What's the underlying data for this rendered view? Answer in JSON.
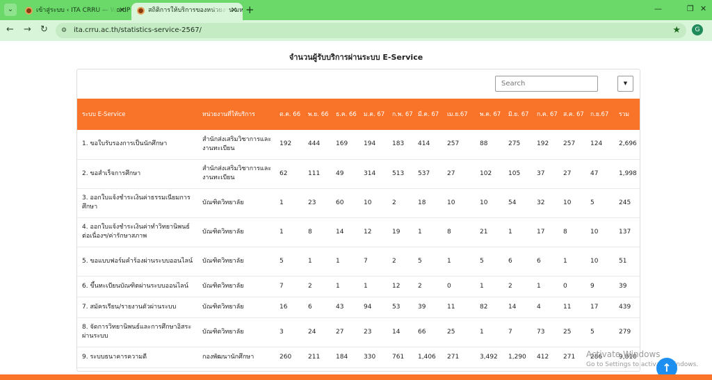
{
  "browser": {
    "tabs": [
      {
        "title": "เข้าสู่ระบบ ‹ ITA CRRU — WordPress"
      },
      {
        "title": "สถิติการให้บริการของหน่วยงาน มหาวิทยาลัย"
      }
    ],
    "url": "ita.crru.ac.th/statistics-service-2567/",
    "profile_initial": "G",
    "icons": {
      "tab_list": "chevron-down-icon",
      "new_tab": "plus-icon",
      "back": "back-arrow-icon",
      "forward": "forward-arrow-icon",
      "reload": "reload-icon",
      "bookmark": "star-icon",
      "scroll_top": "arrow-up-icon"
    }
  },
  "page": {
    "title": "จำนวนผู้รับบริการผ่านระบบ E-Service",
    "search_placeholder": "Search"
  },
  "table": {
    "headers": [
      "ระบบ E-Service",
      "หน่วยงานที่ให้บริการ",
      "ต.ค. 66",
      "พ.ย. 66",
      "ธ.ค. 66",
      "ม.ค. 67",
      "ก.พ. 67",
      "มี.ค. 67",
      "เม.ย.67",
      "พ.ค. 67",
      "มิ.ย. 67",
      "ก.ค. 67",
      "ส.ค. 67",
      "ก.ย.67",
      "รวม"
    ],
    "rows": [
      [
        "1. ขอใบรับรองการเป็นนักศึกษา",
        "สำนักส่งเสริมวิชาการและงานทะเบียน",
        "192",
        "444",
        "169",
        "194",
        "183",
        "414",
        "257",
        "88",
        "275",
        "192",
        "257",
        "124",
        "2,696"
      ],
      [
        "2. ขอสำเร็จการศึกษา",
        "สำนักส่งเสริมวิชาการและงานทะเบียน",
        "62",
        "111",
        "49",
        "314",
        "513",
        "537",
        "27",
        "102",
        "105",
        "37",
        "27",
        "47",
        "1,998"
      ],
      [
        "3. ออกใบแจ้งชำระเงินค่าธรรมเนียมการศึกษา",
        "บัณฑิตวิทยาลัย",
        "1",
        "23",
        "60",
        "10",
        "2",
        "18",
        "10",
        "10",
        "54",
        "32",
        "10",
        "5",
        "245"
      ],
      [
        "4. ออกใบแจ้งชำระเงินค่าทำวิทยานิพนธ์ต่อเนื่องฯ/ค่ารักษาสภาพ",
        "บัณฑิตวิทยาลัย",
        "1",
        "8",
        "14",
        "12",
        "19",
        "1",
        "8",
        "21",
        "1",
        "17",
        "8",
        "10",
        "137"
      ],
      [
        "5. ขอแบบฟอร์มคำร้องผ่านระบบออนไลน์",
        "บัณฑิตวิทยาลัย",
        "5",
        "1",
        "1",
        "7",
        "2",
        "5",
        "1",
        "5",
        "6",
        "6",
        "1",
        "10",
        "51"
      ],
      [
        "6. ขึ้นทะเบียนบัณฑิตผ่านระบบออนไลน์",
        "บัณฑิตวิทยาลัย",
        "7",
        "2",
        "1",
        "1",
        "12",
        "2",
        "0",
        "1",
        "2",
        "1",
        "0",
        "9",
        "39"
      ],
      [
        "7. สมัครเรียน/รายงานตัวผ่านระบบ",
        "บัณฑิตวิทยาลัย",
        "16",
        "6",
        "43",
        "94",
        "53",
        "39",
        "11",
        "82",
        "14",
        "4",
        "11",
        "17",
        "439"
      ],
      [
        "8. จัดการวิทยานิพนธ์และการศึกษาอิสระผ่านระบบ",
        "บัณฑิตวิทยาลัย",
        "3",
        "24",
        "27",
        "23",
        "14",
        "66",
        "25",
        "1",
        "7",
        "73",
        "25",
        "5",
        "279"
      ],
      [
        "9. ระบบธนาคารความดี",
        "กองพัฒนานักศึกษา",
        "260",
        "211",
        "184",
        "330",
        "761",
        "1,406",
        "271",
        "3,492",
        "1,290",
        "412",
        "271",
        "286",
        "9,810"
      ]
    ]
  },
  "overlay": {
    "activate_title": "Activate Windows",
    "activate_sub": "Go to Settings to activate Windows."
  }
}
